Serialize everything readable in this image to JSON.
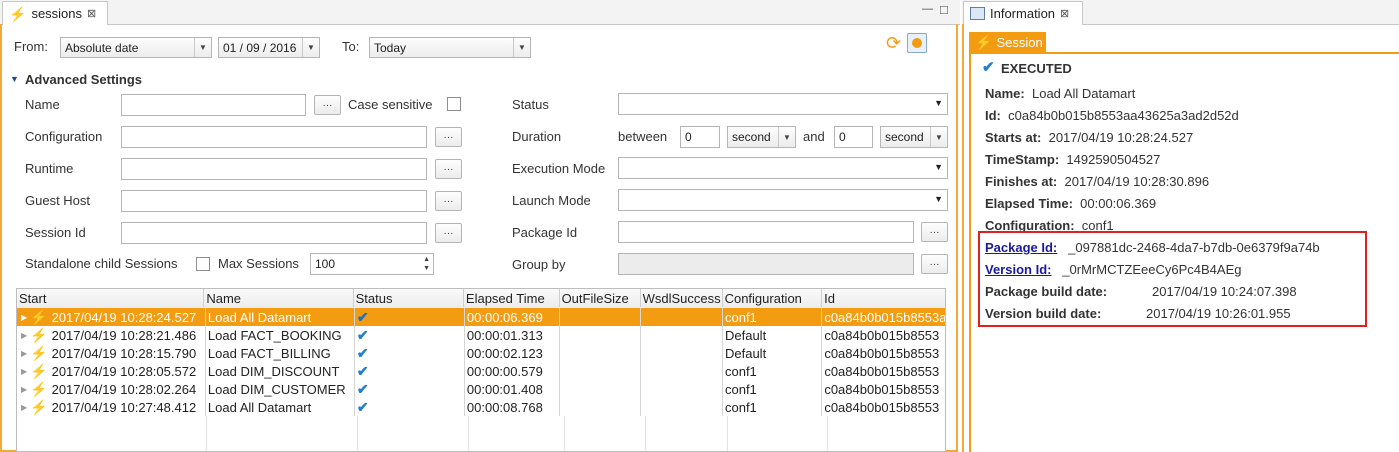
{
  "left_tab": {
    "title": "sessions",
    "close": "⊠"
  },
  "right_tab": {
    "title": "Information",
    "close": "⊠"
  },
  "window_controls": {
    "minimize": "—",
    "maximize": "□"
  },
  "filters": {
    "from_label": "From:",
    "from_value": "Absolute date",
    "date_value": "01 / 09 / 2016",
    "to_label": "To:",
    "to_value": "Today"
  },
  "advanced": {
    "header": "Advanced Settings",
    "name_label": "Name",
    "case_sensitive_label": "Case sensitive",
    "configuration_label": "Configuration",
    "runtime_label": "Runtime",
    "guest_host_label": "Guest Host",
    "session_id_label": "Session Id",
    "standalone_label": "Standalone child Sessions",
    "max_sessions_label": "Max Sessions",
    "max_sessions_value": "100",
    "status_label": "Status",
    "duration_label": "Duration",
    "between_label": "between",
    "duration_from": "0",
    "duration_unit_1": "second",
    "and_label": "and",
    "duration_to": "0",
    "duration_unit_2": "second",
    "execution_mode_label": "Execution Mode",
    "launch_mode_label": "Launch Mode",
    "package_id_label": "Package Id",
    "group_by_label": "Group by",
    "dots": "···"
  },
  "table": {
    "columns": [
      "Start",
      "Name",
      "Status",
      "Elapsed Time",
      "OutFileSize",
      "WsdlSuccess",
      "Configuration",
      "Id"
    ],
    "rows": [
      {
        "start": "2017/04/19 10:28:24.527",
        "name": "Load All Datamart",
        "status": "✔",
        "elapsed": "00:00:06.369",
        "config": "conf1",
        "id": "c0a84b0b015b8553aa43625a3ad2d52d"
      },
      {
        "start": "2017/04/19 10:28:21.486",
        "name": "Load FACT_BOOKING",
        "status": "✔",
        "elapsed": "00:00:01.313",
        "config": "Default",
        "id": "c0a84b0b015b8553"
      },
      {
        "start": "2017/04/19 10:28:15.790",
        "name": "Load FACT_BILLING",
        "status": "✔",
        "elapsed": "00:00:02.123",
        "config": "Default",
        "id": "c0a84b0b015b8553"
      },
      {
        "start": "2017/04/19 10:28:05.572",
        "name": "Load DIM_DISCOUNT",
        "status": "✔",
        "elapsed": "00:00:00.579",
        "config": "conf1",
        "id": "c0a84b0b015b8553"
      },
      {
        "start": "2017/04/19 10:28:02.264",
        "name": "Load DIM_CUSTOMER",
        "status": "✔",
        "elapsed": "00:00:01.408",
        "config": "conf1",
        "id": "c0a84b0b015b8553"
      },
      {
        "start": "2017/04/19 10:27:48.412",
        "name": "Load All Datamart",
        "status": "✔",
        "elapsed": "00:00:08.768",
        "config": "conf1",
        "id": "c0a84b0b015b8553"
      }
    ]
  },
  "info": {
    "session_tab": "Session",
    "status": "EXECUTED",
    "name_label": "Name:",
    "name_value": "Load All Datamart",
    "id_label": "Id:",
    "id_value": "c0a84b0b015b8553aa43625a3ad2d52d",
    "starts_label": "Starts at:",
    "starts_value": "2017/04/19 10:28:24.527",
    "timestamp_label": "TimeStamp:",
    "timestamp_value": "1492590504527",
    "finishes_label": "Finishes at:",
    "finishes_value": "2017/04/19 10:28:30.896",
    "elapsed_label": "Elapsed Time:",
    "elapsed_value": "00:00:06.369",
    "configuration_label": "Configuration:",
    "configuration_value": "conf1",
    "package_id_label": "Package Id:",
    "package_id_value": "_097881dc-2468-4da7-b7db-0e6379f9a74b",
    "version_id_label": "Version Id:",
    "version_id_value": "_0rMrMCTZEeeCy6Pc4B4AEg",
    "package_build_label": "Package build date:",
    "package_build_value": "2017/04/19 10:24:07.398",
    "version_build_label": "Version build date:",
    "version_build_value": "2017/04/19 10:26:01.955"
  },
  "colors": {
    "accent": "#f39c12",
    "highlight_box": "#e02020",
    "link": "#1a1aa0"
  }
}
